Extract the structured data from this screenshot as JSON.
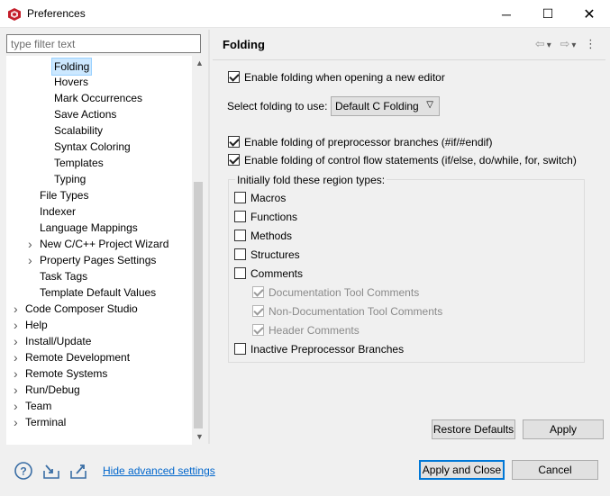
{
  "window": {
    "title": "Preferences",
    "minimize": "─",
    "maximize": "☐",
    "close": "✕"
  },
  "filter": {
    "placeholder": "type filter text"
  },
  "tree": {
    "items": [
      {
        "label": "Folding",
        "indent": 3,
        "selected": true
      },
      {
        "label": "Hovers",
        "indent": 3
      },
      {
        "label": "Mark Occurrences",
        "indent": 3
      },
      {
        "label": "Save Actions",
        "indent": 3
      },
      {
        "label": "Scalability",
        "indent": 3
      },
      {
        "label": "Syntax Coloring",
        "indent": 3
      },
      {
        "label": "Templates",
        "indent": 3
      },
      {
        "label": "Typing",
        "indent": 3
      },
      {
        "label": "File Types",
        "indent": 2
      },
      {
        "label": "Indexer",
        "indent": 2
      },
      {
        "label": "Language Mappings",
        "indent": 2
      },
      {
        "label": "New C/C++ Project Wizard",
        "indent": 2,
        "expandable": true
      },
      {
        "label": "Property Pages Settings",
        "indent": 2,
        "expandable": true
      },
      {
        "label": "Task Tags",
        "indent": 2
      },
      {
        "label": "Template Default Values",
        "indent": 2
      },
      {
        "label": "Code Composer Studio",
        "indent": 1,
        "expandable": true
      },
      {
        "label": "Help",
        "indent": 1,
        "expandable": true
      },
      {
        "label": "Install/Update",
        "indent": 1,
        "expandable": true
      },
      {
        "label": "Remote Development",
        "indent": 1,
        "expandable": true
      },
      {
        "label": "Remote Systems",
        "indent": 1,
        "expandable": true
      },
      {
        "label": "Run/Debug",
        "indent": 1,
        "expandable": true
      },
      {
        "label": "Team",
        "indent": 1,
        "expandable": true
      },
      {
        "label": "Terminal",
        "indent": 1,
        "expandable": true
      }
    ]
  },
  "page": {
    "title": "Folding",
    "nav": {
      "back": "⇦",
      "back_menu": "▾",
      "forward": "⇨",
      "forward_menu": "▾",
      "more": "⋮"
    },
    "enable_on_open": {
      "label": "Enable folding when opening a new editor",
      "checked": true
    },
    "select": {
      "label": "Select folding to use:",
      "value": "Default C Folding"
    },
    "preproc": {
      "label": "Enable folding of preprocessor branches (#if/#endif)",
      "checked": true
    },
    "control_flow": {
      "label": "Enable folding of control flow statements (if/else, do/while, for, switch)",
      "checked": true
    },
    "group": {
      "title": "Initially fold these region types:",
      "items": [
        {
          "label": "Macros",
          "checked": false,
          "disabled": false
        },
        {
          "label": "Functions",
          "checked": false,
          "disabled": false
        },
        {
          "label": "Methods",
          "checked": false,
          "disabled": false
        },
        {
          "label": "Structures",
          "checked": false,
          "disabled": false
        },
        {
          "label": "Comments",
          "checked": false,
          "disabled": false
        },
        {
          "label": "Documentation Tool Comments",
          "checked": true,
          "disabled": true
        },
        {
          "label": "Non-Documentation Tool Comments",
          "checked": true,
          "disabled": true
        },
        {
          "label": "Header Comments",
          "checked": true,
          "disabled": true
        },
        {
          "label": "Inactive Preprocessor Branches",
          "checked": false,
          "disabled": false
        }
      ]
    },
    "restore_defaults": "Restore Defaults",
    "apply": "Apply"
  },
  "footer": {
    "help_icon": "help-icon",
    "import_icon": "import-icon",
    "export_icon": "export-icon",
    "advanced_link": "Hide advanced settings",
    "apply_close": "Apply and Close",
    "cancel": "Cancel"
  },
  "colors": {
    "accent": "#0078d7",
    "selection": "#cce8ff",
    "link": "#0066cc"
  }
}
